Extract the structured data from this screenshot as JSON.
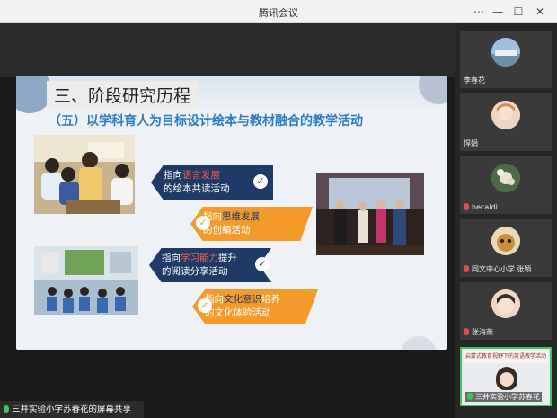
{
  "window": {
    "title": "腾讯会议",
    "min_icon": "minimize-icon",
    "max_icon": "maximize-icon",
    "close_icon": "close-icon"
  },
  "slide": {
    "heading": "三、阶段研究历程",
    "subheading": "（五）以学科育人为目标设计绘本与教材融合的教学活动",
    "banners": [
      {
        "prefix": "指向",
        "highlight": "语言发展",
        "line2": "的绘本共读活动"
      },
      {
        "prefix": "指向",
        "highlight": "思维发展",
        "line2": "的创编活动"
      },
      {
        "prefix": "指向",
        "highlight": "学习能力",
        "suffix": "提升",
        "line2": "的阅读分享活动"
      },
      {
        "prefix": "指向",
        "highlight": "文化意识",
        "suffix": "培养",
        "line2": "的文化体验活动"
      }
    ]
  },
  "share_bar": {
    "label": "三井实验小学苏春花的屏幕共享"
  },
  "participants": [
    {
      "name": "李春花",
      "mic": "muted"
    },
    {
      "name": "悍娟",
      "mic": "none"
    },
    {
      "name": "hecaidi",
      "mic": "muted"
    },
    {
      "name": "同文中心小学 张颖",
      "mic": "muted"
    },
    {
      "name": "张海燕",
      "mic": "muted"
    },
    {
      "name": "三井实验小学苏春花",
      "mic": "active",
      "banner_text": "启蒙式教育视野下的英语教学活动"
    }
  ],
  "colors": {
    "navy": "#1e3a66",
    "orange": "#f39a2b",
    "accent_blue": "#2a7cc4",
    "highlight_red": "#ff5a4e"
  }
}
